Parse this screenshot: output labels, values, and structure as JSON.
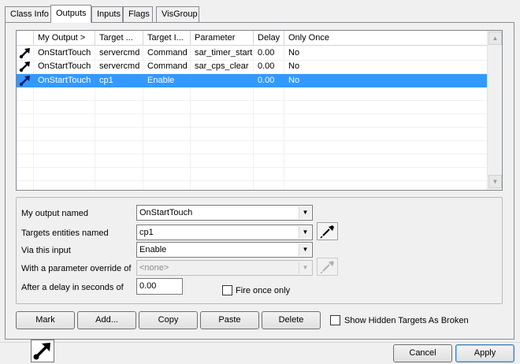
{
  "tabs": [
    "Class Info",
    "Outputs",
    "Inputs",
    "Flags",
    "VisGroup"
  ],
  "outputs_list": {
    "columns": [
      "My Output  >",
      "Target ...",
      "Target I...",
      "Parameter",
      "Delay",
      "Only Once"
    ],
    "rows": [
      {
        "output": "OnStartTouch",
        "target": "servercmd",
        "input": "Command",
        "parameter": "sar_timer_start",
        "delay": "0.00",
        "once": "No"
      },
      {
        "output": "OnStartTouch",
        "target": "servercmd",
        "input": "Command",
        "parameter": "sar_cps_clear",
        "delay": "0.00",
        "once": "No"
      },
      {
        "output": "OnStartTouch",
        "target": "cp1",
        "input": "Enable",
        "parameter": "",
        "delay": "0.00",
        "once": "No"
      }
    ],
    "selected_row": 2
  },
  "form": {
    "output_label": "My output named",
    "output_value": "OnStartTouch",
    "target_label": "Targets entities named",
    "target_value": "cp1",
    "input_label": "Via this input",
    "input_value": "Enable",
    "param_label": "With a parameter override of",
    "param_value": "<none>",
    "delay_label": "After a delay in seconds of",
    "delay_value": "0.00",
    "fire_once_label": "Fire once only"
  },
  "buttons": {
    "mark": "Mark",
    "add": "Add...",
    "copy": "Copy",
    "paste": "Paste",
    "delete": "Delete",
    "show_hidden": "Show Hidden Targets As Broken",
    "cancel": "Cancel",
    "apply": "Apply"
  },
  "colors": {
    "selection": "#3399ff",
    "accent_border": "#3c7fb1"
  }
}
